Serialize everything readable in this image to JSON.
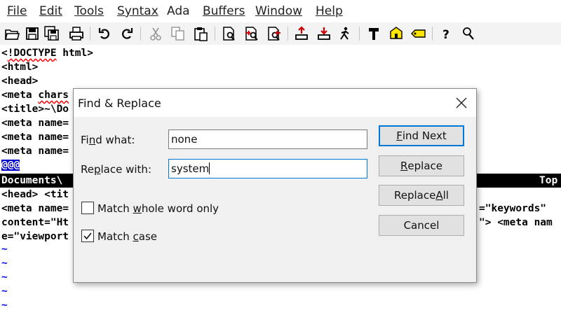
{
  "menu": {
    "file": "File",
    "edit": "Edit",
    "tools": "Tools",
    "syntax": "Syntax",
    "ada": "Ada",
    "buffers": "Buffers",
    "window": "Window",
    "help": "Help"
  },
  "toolbar": {
    "icons": [
      "open-icon",
      "save-icon",
      "save-all-icon",
      "print-icon",
      "undo-icon",
      "redo-icon",
      "cut-icon",
      "copy-icon",
      "paste-icon",
      "find-icon",
      "find-next-icon",
      "find-prev-icon",
      "load-session-icon",
      "save-session-icon",
      "run-script-icon",
      "make-icon",
      "shell-icon",
      "ctags-icon",
      "help-icon",
      "find-help-icon"
    ]
  },
  "editor": {
    "lines": [
      {
        "pre": "<",
        "sq": "!DOCTYPE",
        "post": " html>"
      },
      {
        "pre": "<html>",
        "sq": "",
        "post": ""
      },
      {
        "pre": "<head>",
        "sq": "",
        "post": ""
      },
      {
        "pre": "<meta ",
        "sq": "chars",
        "post": ""
      },
      {
        "pre": "<title>~\\Do",
        "sq": "",
        "post": ""
      },
      {
        "pre": "<meta name=",
        "sq": "",
        "post": ""
      },
      {
        "pre": "<meta name=",
        "sq": "",
        "post": ""
      },
      {
        "pre": "<meta name=",
        "sq": "",
        "post": ""
      }
    ],
    "marker": "@@@",
    "status_left": "Documents\\",
    "status_right": "Top",
    "lower_lines": [
      {
        "left": "<head> <tit",
        "right": ""
      },
      {
        "left": "<meta name=",
        "right": "=\"keywords\""
      },
      {
        "left": "content=\"Ht",
        "right": "\"> <meta nam"
      },
      {
        "left": "e=\"viewport",
        "right": ""
      }
    ],
    "tilde": "~"
  },
  "dialog": {
    "title": "Find & Replace",
    "find_label_pre": "Fi",
    "find_label_u": "n",
    "find_label_post": "d what:",
    "find_value": "none",
    "replace_label_pre": "Re",
    "replace_label_u": "p",
    "replace_label_post": "lace with:",
    "replace_value": "system",
    "match_whole_pre": "Match ",
    "match_whole_u": "w",
    "match_whole_post": "hole word only",
    "match_whole_checked": false,
    "match_case_pre": "Match ",
    "match_case_u": "c",
    "match_case_post": "ase",
    "match_case_checked": true,
    "find_next_pre": "",
    "find_next_u": "F",
    "find_next_post": "ind Next",
    "replace_pre": "",
    "replace_u": "R",
    "replace_post": "eplace",
    "replace_all_pre": "Replace ",
    "replace_all_u": "A",
    "replace_all_post": "ll",
    "cancel": "Cancel"
  },
  "colors": {
    "accent": "#0078d7",
    "tilde": "#0000ff",
    "marker_bg": "#0000cc",
    "status_bg": "#000000"
  }
}
